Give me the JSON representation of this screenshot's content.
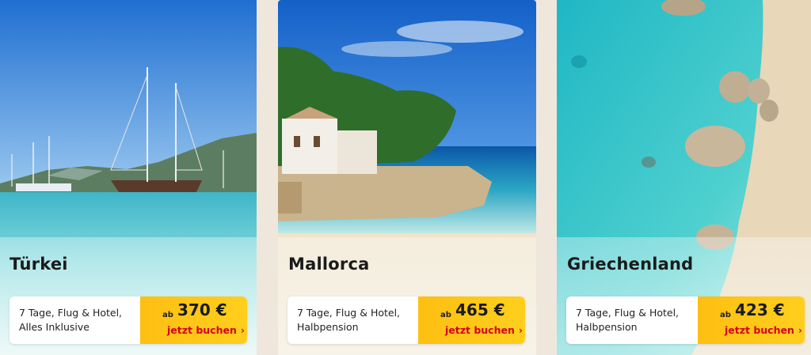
{
  "offers": [
    {
      "destination": "Türkei",
      "line1": "7 Tage, Flug & Hotel,",
      "line2": "Alles Inklusive",
      "ab": "ab",
      "price": "370 €",
      "cta": "jetzt buchen",
      "chevron": "›"
    },
    {
      "destination": "Mallorca",
      "line1": "7 Tage, Flug & Hotel,",
      "line2": "Halbpension",
      "ab": "ab",
      "price": "465 €",
      "cta": "jetzt buchen",
      "chevron": "›"
    },
    {
      "destination": "Griechenland",
      "line1": "7 Tage, Flug & Hotel,",
      "line2": "Halbpension",
      "ab": "ab",
      "price": "423 €",
      "cta": "jetzt buchen",
      "chevron": "›"
    }
  ],
  "colors": {
    "background": "#efe7dc",
    "cta_button": "#fdbf12",
    "cta_text": "#d5001c"
  },
  "icons": {
    "cta_chevron": "chevron-right-icon"
  }
}
